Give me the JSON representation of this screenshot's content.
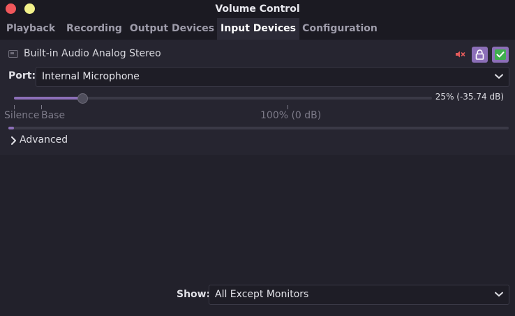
{
  "window": {
    "title": "Volume Control"
  },
  "tabs": [
    {
      "label": "Playback",
      "active": false
    },
    {
      "label": "Recording",
      "active": false
    },
    {
      "label": "Output Devices",
      "active": false
    },
    {
      "label": "Input Devices",
      "active": true
    },
    {
      "label": "Configuration",
      "active": false
    }
  ],
  "device": {
    "name": "Built-in Audio Analog Stereo",
    "port_label": "Port:",
    "port_value": "Internal Microphone",
    "volume_percent": 25,
    "volume_readout": "25% (-35.74 dB)",
    "marks": {
      "silence": "Silence",
      "base": "Base",
      "hundred": "100% (0 dB)"
    },
    "level_meter_fraction": 0.01,
    "advanced_label": "Advanced",
    "controls": {
      "mute_icon": "mute-speaker-icon",
      "lock_icon": "lock-icon",
      "default_icon": "checkmark-icon"
    }
  },
  "footer": {
    "show_label": "Show:",
    "show_value": "All Except Monitors"
  },
  "colors": {
    "accent": "#8c6fb8",
    "mute_red": "#e05a5a",
    "check_green": "#3fae4d",
    "close_red": "#f0575b",
    "minimize_yellow": "#f1f08a"
  }
}
